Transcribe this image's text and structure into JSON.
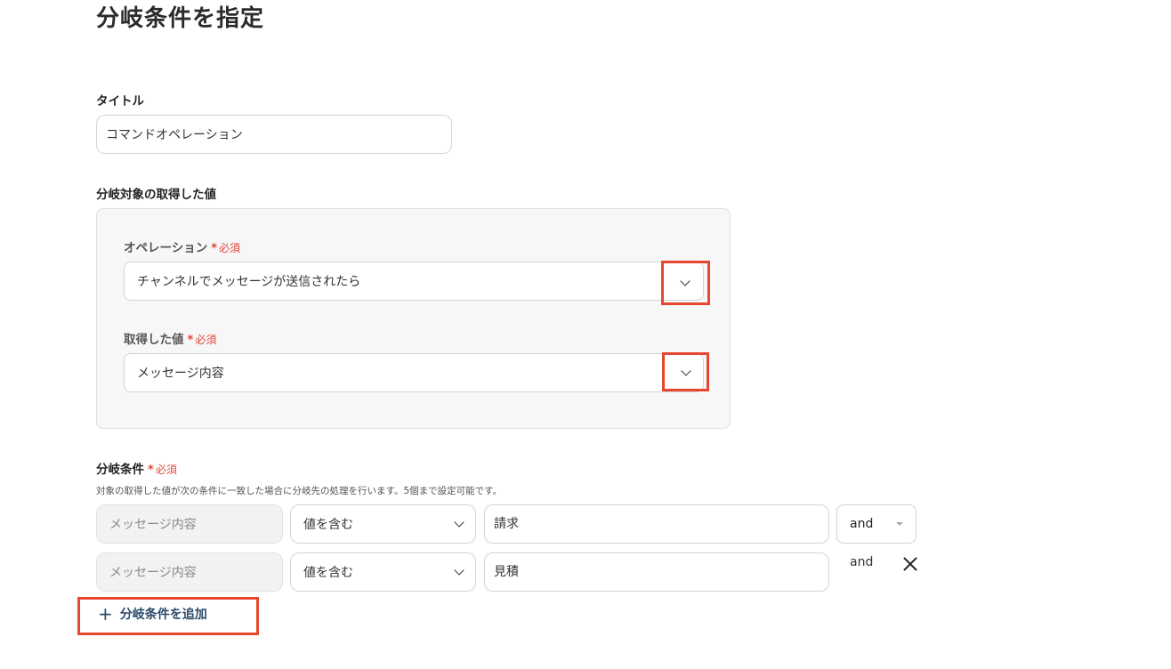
{
  "page": {
    "title": "分岐条件を指定"
  },
  "title_field": {
    "label": "タイトル",
    "value": "コマンドオペレーション"
  },
  "branch_target": {
    "label": "分岐対象の取得した値",
    "operation": {
      "label": "オペレーション",
      "required_star": "*",
      "required": "必須",
      "value": "チャンネルでメッセージが送信されたら"
    },
    "acquired_value": {
      "label": "取得した値",
      "required_star": "*",
      "required": "必須",
      "value": "メッセージ内容"
    }
  },
  "conditions": {
    "label": "分岐条件",
    "required_star": "*",
    "required": "必須",
    "help": "対象の取得した値が次の条件に一致した場合に分岐先の処理を行います。5個まで設定可能です。",
    "rows": [
      {
        "field": "メッセージ内容",
        "operator": "値を含む",
        "value": "請求",
        "conjunction": "and"
      },
      {
        "field": "メッセージ内容",
        "operator": "値を含む",
        "value": "見積",
        "conjunction": "and"
      }
    ],
    "add_label": "分岐条件を追加"
  },
  "colors": {
    "highlight": "#e8472f",
    "required": "#e0473a",
    "add_button": "#2a4a6a"
  }
}
